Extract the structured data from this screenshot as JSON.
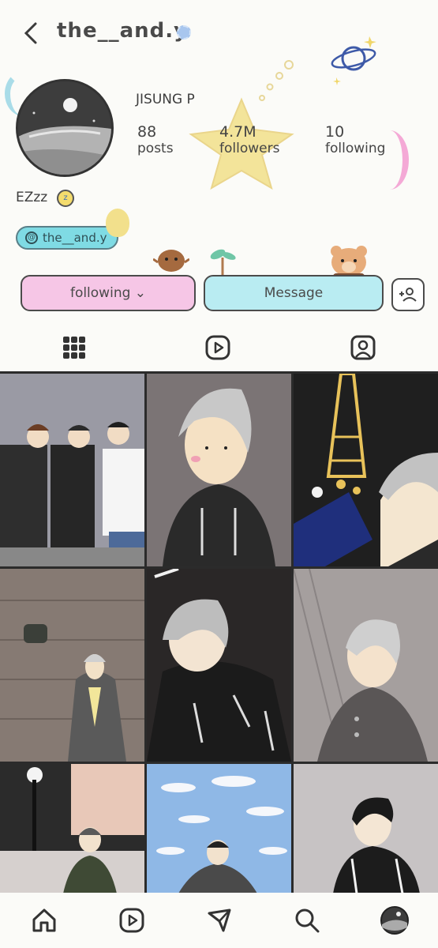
{
  "header": {
    "username": "the__and.y"
  },
  "profile": {
    "display_name": "JISUNG P",
    "bio": "EZzz",
    "link_label": "the__and.y",
    "stats": [
      {
        "number": "88",
        "label": "posts"
      },
      {
        "number": "4.7M",
        "label": "followers"
      },
      {
        "number": "10",
        "label": "following"
      }
    ]
  },
  "actions": {
    "following_label": "following ⌄",
    "message_label": "Message"
  },
  "colors": {
    "following_button": "#f6c6e6",
    "message_button": "#b9ecf2",
    "link_chip": "#7fdbe4",
    "star": "#f3e49a"
  },
  "tabs": [
    "grid-icon",
    "reels-icon",
    "tagged-icon"
  ],
  "bottom_nav": [
    "home-icon",
    "reels-icon",
    "explore-icon",
    "search-icon",
    "profile-avatar"
  ]
}
